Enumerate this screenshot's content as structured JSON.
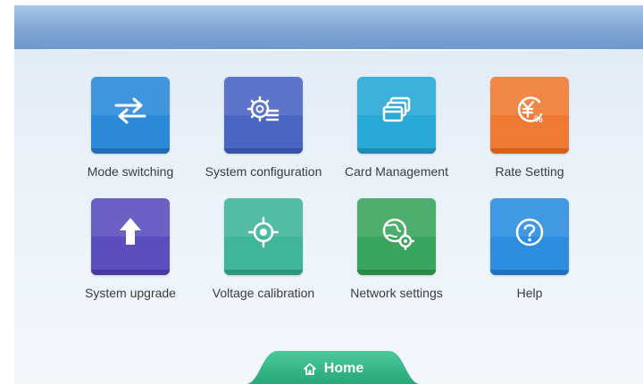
{
  "colors": {
    "mode_switching": "#2c8ad8",
    "system_configuration": "#4a66c4",
    "card_management": "#29a9d6",
    "rate_setting": "#ef7a33",
    "system_upgrade": "#5b4ebd",
    "voltage_calibration": "#3fb59a",
    "network_settings": "#3aa55d",
    "help": "#2d8ee0",
    "home_tab": "#34b886"
  },
  "tiles": [
    {
      "label": "Mode switching",
      "icon": "swap-arrows-icon"
    },
    {
      "label": "System configuration",
      "icon": "gear-list-icon"
    },
    {
      "label": "Card Management",
      "icon": "cards-icon"
    },
    {
      "label": "Rate Setting",
      "icon": "yen-percent-icon"
    },
    {
      "label": "System upgrade",
      "icon": "upload-arrow-icon"
    },
    {
      "label": "Voltage calibration",
      "icon": "crosshair-icon"
    },
    {
      "label": "Network settings",
      "icon": "globe-gear-icon"
    },
    {
      "label": "Help",
      "icon": "help-circle-icon"
    }
  ],
  "home": {
    "label": "Home",
    "icon": "home-icon"
  }
}
